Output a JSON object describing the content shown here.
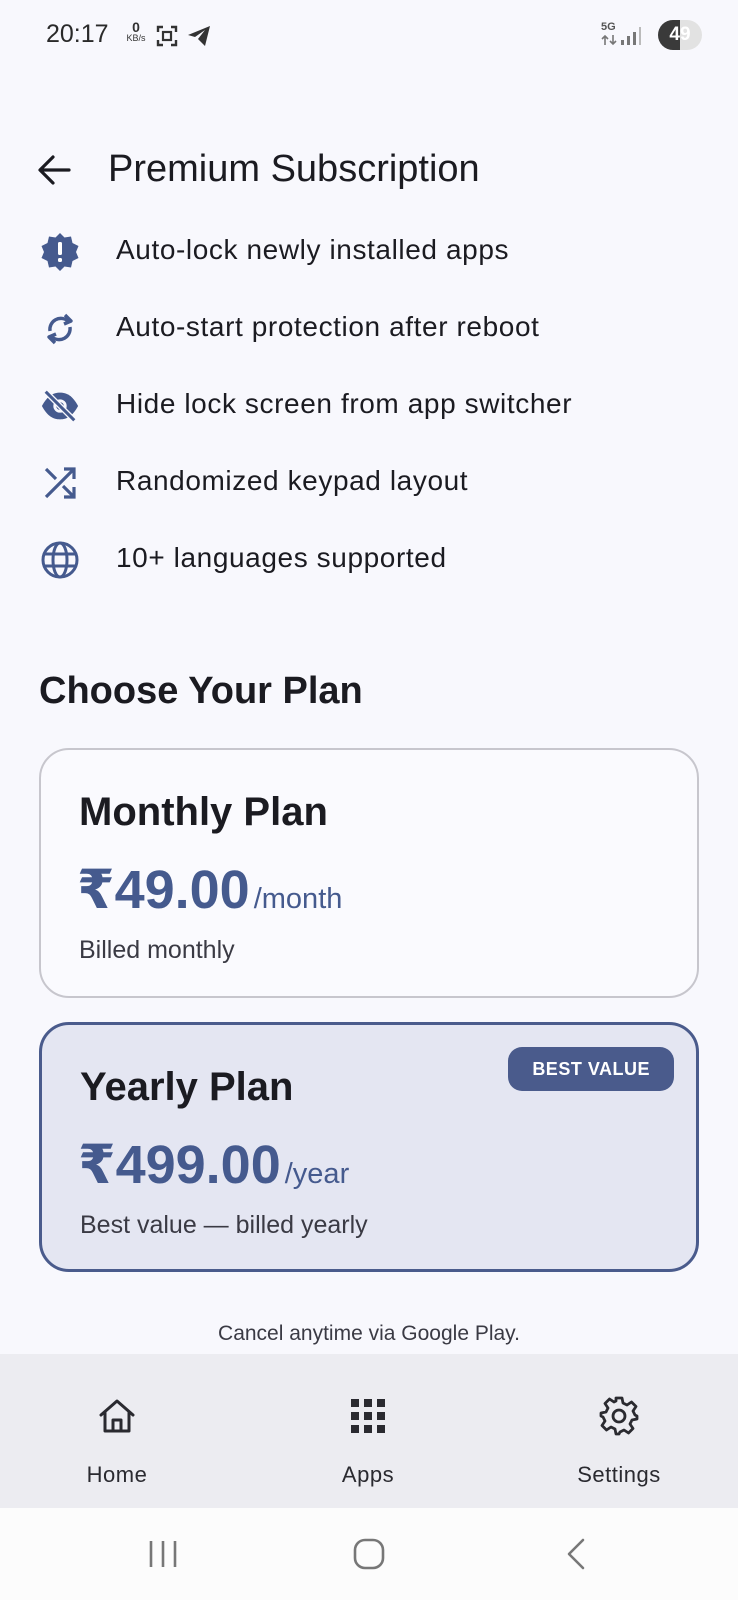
{
  "status_bar": {
    "time": "20:17",
    "net_speed_value": "0",
    "net_speed_unit": "KB/s",
    "network_type": "5G",
    "battery": "49"
  },
  "header": {
    "title": "Premium Subscription"
  },
  "features": [
    {
      "icon": "alert-badge-icon",
      "label": "Auto-lock newly installed apps"
    },
    {
      "icon": "sync-icon",
      "label": "Auto-start protection after reboot"
    },
    {
      "icon": "eye-off-icon",
      "label": "Hide lock screen from app switcher"
    },
    {
      "icon": "shuffle-icon",
      "label": "Randomized keypad layout"
    },
    {
      "icon": "globe-icon",
      "label": "10+ languages supported"
    }
  ],
  "plans_section": {
    "title": "Choose Your Plan",
    "monthly": {
      "name": "Monthly Plan",
      "price": "₹49.00",
      "period": "/month",
      "note": "Billed monthly"
    },
    "yearly": {
      "name": "Yearly Plan",
      "price": "₹499.00",
      "period": "/year",
      "note": "Best value — billed yearly",
      "badge": "BEST VALUE"
    },
    "cancel_note": "Cancel anytime via Google Play."
  },
  "bottom_nav": {
    "items": [
      {
        "icon": "home-icon",
        "label": "Home"
      },
      {
        "icon": "apps-grid-icon",
        "label": "Apps"
      },
      {
        "icon": "gear-icon",
        "label": "Settings"
      }
    ]
  },
  "colors": {
    "accent": "#455a8e",
    "background": "#f8f8fd",
    "selected_card": "#e4e6f2"
  }
}
